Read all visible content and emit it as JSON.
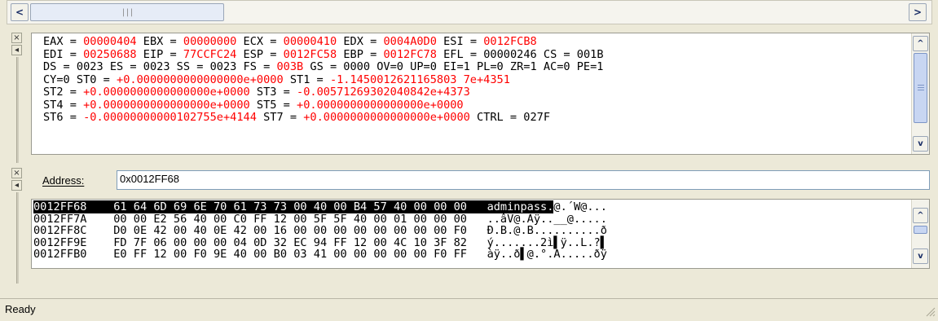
{
  "registers": {
    "lines": [
      [
        {
          "t": "EAX = "
        },
        {
          "t": "00000404",
          "red": true
        },
        {
          "t": " EBX = "
        },
        {
          "t": "00000000",
          "red": true
        },
        {
          "t": " ECX = "
        },
        {
          "t": "00000410",
          "red": true
        },
        {
          "t": " EDX = "
        },
        {
          "t": "0004A0D0",
          "red": true
        },
        {
          "t": " ESI = "
        },
        {
          "t": "0012FCB8",
          "red": true
        }
      ],
      [
        {
          "t": "EDI = "
        },
        {
          "t": "00250688",
          "red": true
        },
        {
          "t": " EIP = "
        },
        {
          "t": "77CCFC24",
          "red": true
        },
        {
          "t": " ESP = "
        },
        {
          "t": "0012FC58",
          "red": true
        },
        {
          "t": " EBP = "
        },
        {
          "t": "0012FC78",
          "red": true
        },
        {
          "t": " EFL = 00000246 CS = 001B"
        }
      ],
      [
        {
          "t": "DS = 0023 ES = 0023 SS = 0023 FS = "
        },
        {
          "t": "003B",
          "red": true
        },
        {
          "t": " GS = 0000 OV=0 UP=0 EI=1 PL=0 ZR=1 AC=0 PE=1"
        }
      ],
      [
        {
          "t": "CY=0 ST0 = "
        },
        {
          "t": "+0.0000000000000000e+0000",
          "red": true
        },
        {
          "t": " ST1 = "
        },
        {
          "t": "-1.1450012621165803 7e+4351",
          "red": true
        }
      ],
      [
        {
          "t": "ST2 = "
        },
        {
          "t": "+0.0000000000000000e+0000",
          "red": true
        },
        {
          "t": " ST3 = "
        },
        {
          "t": "-0.00571269302040842e+4373",
          "red": true
        }
      ],
      [
        {
          "t": "ST4 = "
        },
        {
          "t": "+0.0000000000000000e+0000",
          "red": true
        },
        {
          "t": " ST5 = "
        },
        {
          "t": "+0.0000000000000000e+0000",
          "red": true
        }
      ],
      [
        {
          "t": "ST6 = "
        },
        {
          "t": "-0.00000000000102755e+4144",
          "red": true
        },
        {
          "t": " ST7 = "
        },
        {
          "t": "+0.0000000000000000e+0000",
          "red": true
        },
        {
          "t": " CTRL = 027F"
        }
      ]
    ]
  },
  "memory": {
    "address_label": "Address:",
    "address_value": "0x0012FF68",
    "rows": [
      {
        "addr": "0012FF68",
        "hex": "61 64 6D 69 6E 70 61 73 73 00 40 00 B4 57 40 00 00 00",
        "ascii": "adminpass.",
        "ascii_rest": "@.´W@...",
        "selected": true
      },
      {
        "addr": "0012FF7A",
        "hex": "00 00 E2 56 40 00 C0 FF 12 00 5F 5F 40 00 01 00 00 00",
        "ascii": "..âV@.Àÿ..__@.....",
        "selected": false
      },
      {
        "addr": "0012FF8C",
        "hex": "D0 0E 42 00 40 0E 42 00 16 00 00 00 00 00 00 00 00 F0",
        "ascii": "Ð.B.@.B..........ð",
        "selected": false
      },
      {
        "addr": "0012FF9E",
        "hex": "FD 7F 06 00 00 00 04 0D 32 EC 94 FF 12 00 4C 10 3F 82",
        "ascii": "ý.......2ì▌ÿ..L.?▌",
        "selected": false
      },
      {
        "addr": "0012FFB0",
        "hex": "E0 FF 12 00 F0 9E 40 00 B0 03 41 00 00 00 00 00 F0 FF",
        "ascii": "àÿ..ð▌@.°.A.....ðÿ",
        "selected": false
      }
    ]
  },
  "status": {
    "text": "Ready"
  },
  "icons": {
    "left_arrow": "◀",
    "right_arrow": "▶",
    "up": "▲",
    "down": "▼",
    "close": "✕"
  }
}
